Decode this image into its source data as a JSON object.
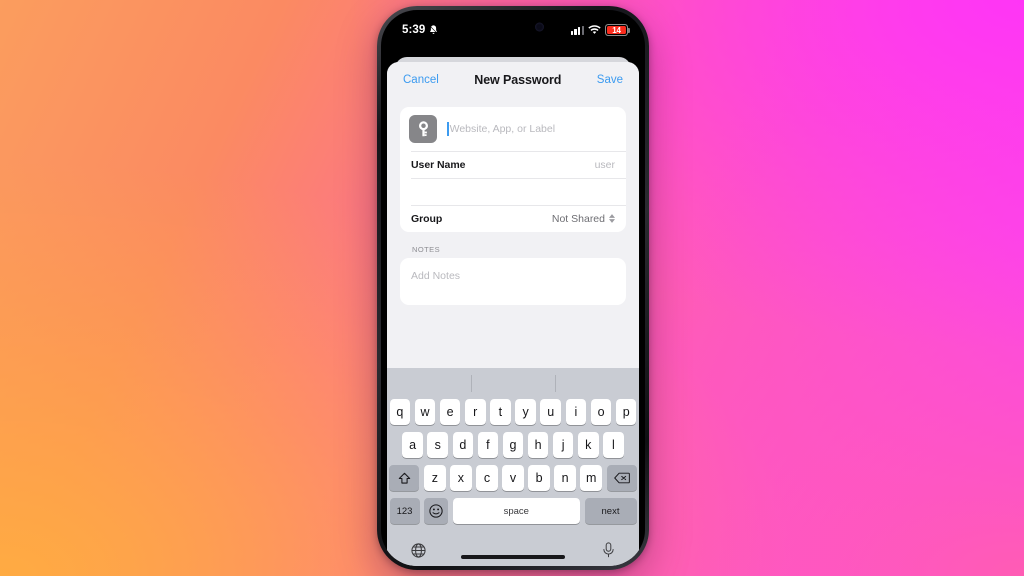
{
  "background": {
    "gradient_from": "#fb9d5e",
    "gradient_mid": "#ff62a9",
    "gradient_to": "#fd3ff8"
  },
  "status_bar": {
    "time": "5:39",
    "mute_icon": "bell-slash-icon",
    "signal_icon": "cellular-signal-icon",
    "wifi_icon": "wifi-icon",
    "battery_percent": "14",
    "battery_level": 14,
    "battery_color": "#fb2c1d"
  },
  "nav": {
    "cancel_label": "Cancel",
    "title": "New Password",
    "save_label": "Save",
    "link_color": "#3c9bf0"
  },
  "form": {
    "title_row": {
      "icon": "key-icon",
      "placeholder": "Website, App, or Label",
      "value": ""
    },
    "fields": [
      {
        "label": "User Name",
        "value": "",
        "placeholder": "user"
      },
      {
        "label": "",
        "value": "",
        "placeholder": ""
      }
    ],
    "group_row": {
      "label": "Group",
      "value": "Not Shared",
      "stepper_icon": "chevron-up-down-icon"
    },
    "notes": {
      "section_label": "NOTES",
      "placeholder": "Add Notes"
    }
  },
  "keyboard": {
    "row1": [
      "q",
      "w",
      "e",
      "r",
      "t",
      "y",
      "u",
      "i",
      "o",
      "p"
    ],
    "row2": [
      "a",
      "s",
      "d",
      "f",
      "g",
      "h",
      "j",
      "k",
      "l"
    ],
    "row3": [
      "z",
      "x",
      "c",
      "v",
      "b",
      "n",
      "m"
    ],
    "shift_icon": "shift-up-arrow-icon",
    "delete_icon": "backspace-delete-icon",
    "numbers_label": "123",
    "emoji_icon": "emoji-smiley-icon",
    "space_label": "space",
    "return_label": "next",
    "globe_icon": "globe-language-icon",
    "mic_icon": "microphone-dictation-icon"
  }
}
